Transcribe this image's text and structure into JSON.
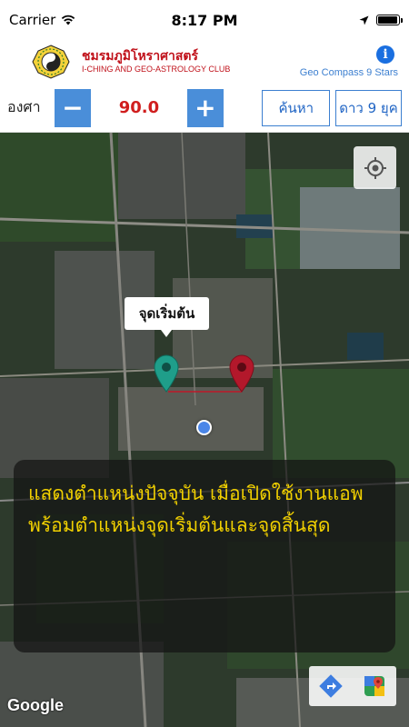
{
  "status_bar": {
    "carrier": "Carrier",
    "time": "8:17 PM",
    "battery_level": 0.95
  },
  "header": {
    "club_name_thai": "ชมรมภูมิโหราศาสตร์",
    "club_name_en": "I-CHING AND GEO-ASTROLOGY CLUB",
    "app_title": "Geo Compass 9 Stars",
    "info_icon": "info-icon"
  },
  "controls": {
    "degree_label": "องศา",
    "decrement_label": "−",
    "degree_value": "90.0",
    "increment_label": "+",
    "search_label": "ค้นหา",
    "nine_stars_label": "ดาว 9 ยุค"
  },
  "map": {
    "start_callout": "จุดเริ่มต้น",
    "description": "แสดงตำแหน่งปัจจุบัน เมื่อเปิดใช้งานแอพ พร้อมตำแหน่งจุดเริ่มต้นและจุดสิ้นสุด",
    "attribution": "Google",
    "start_pin_color": "#1f9e8a",
    "end_pin_color": "#b3182b",
    "current_location_color": "#4a86e8",
    "text_color": "#f1d000"
  }
}
